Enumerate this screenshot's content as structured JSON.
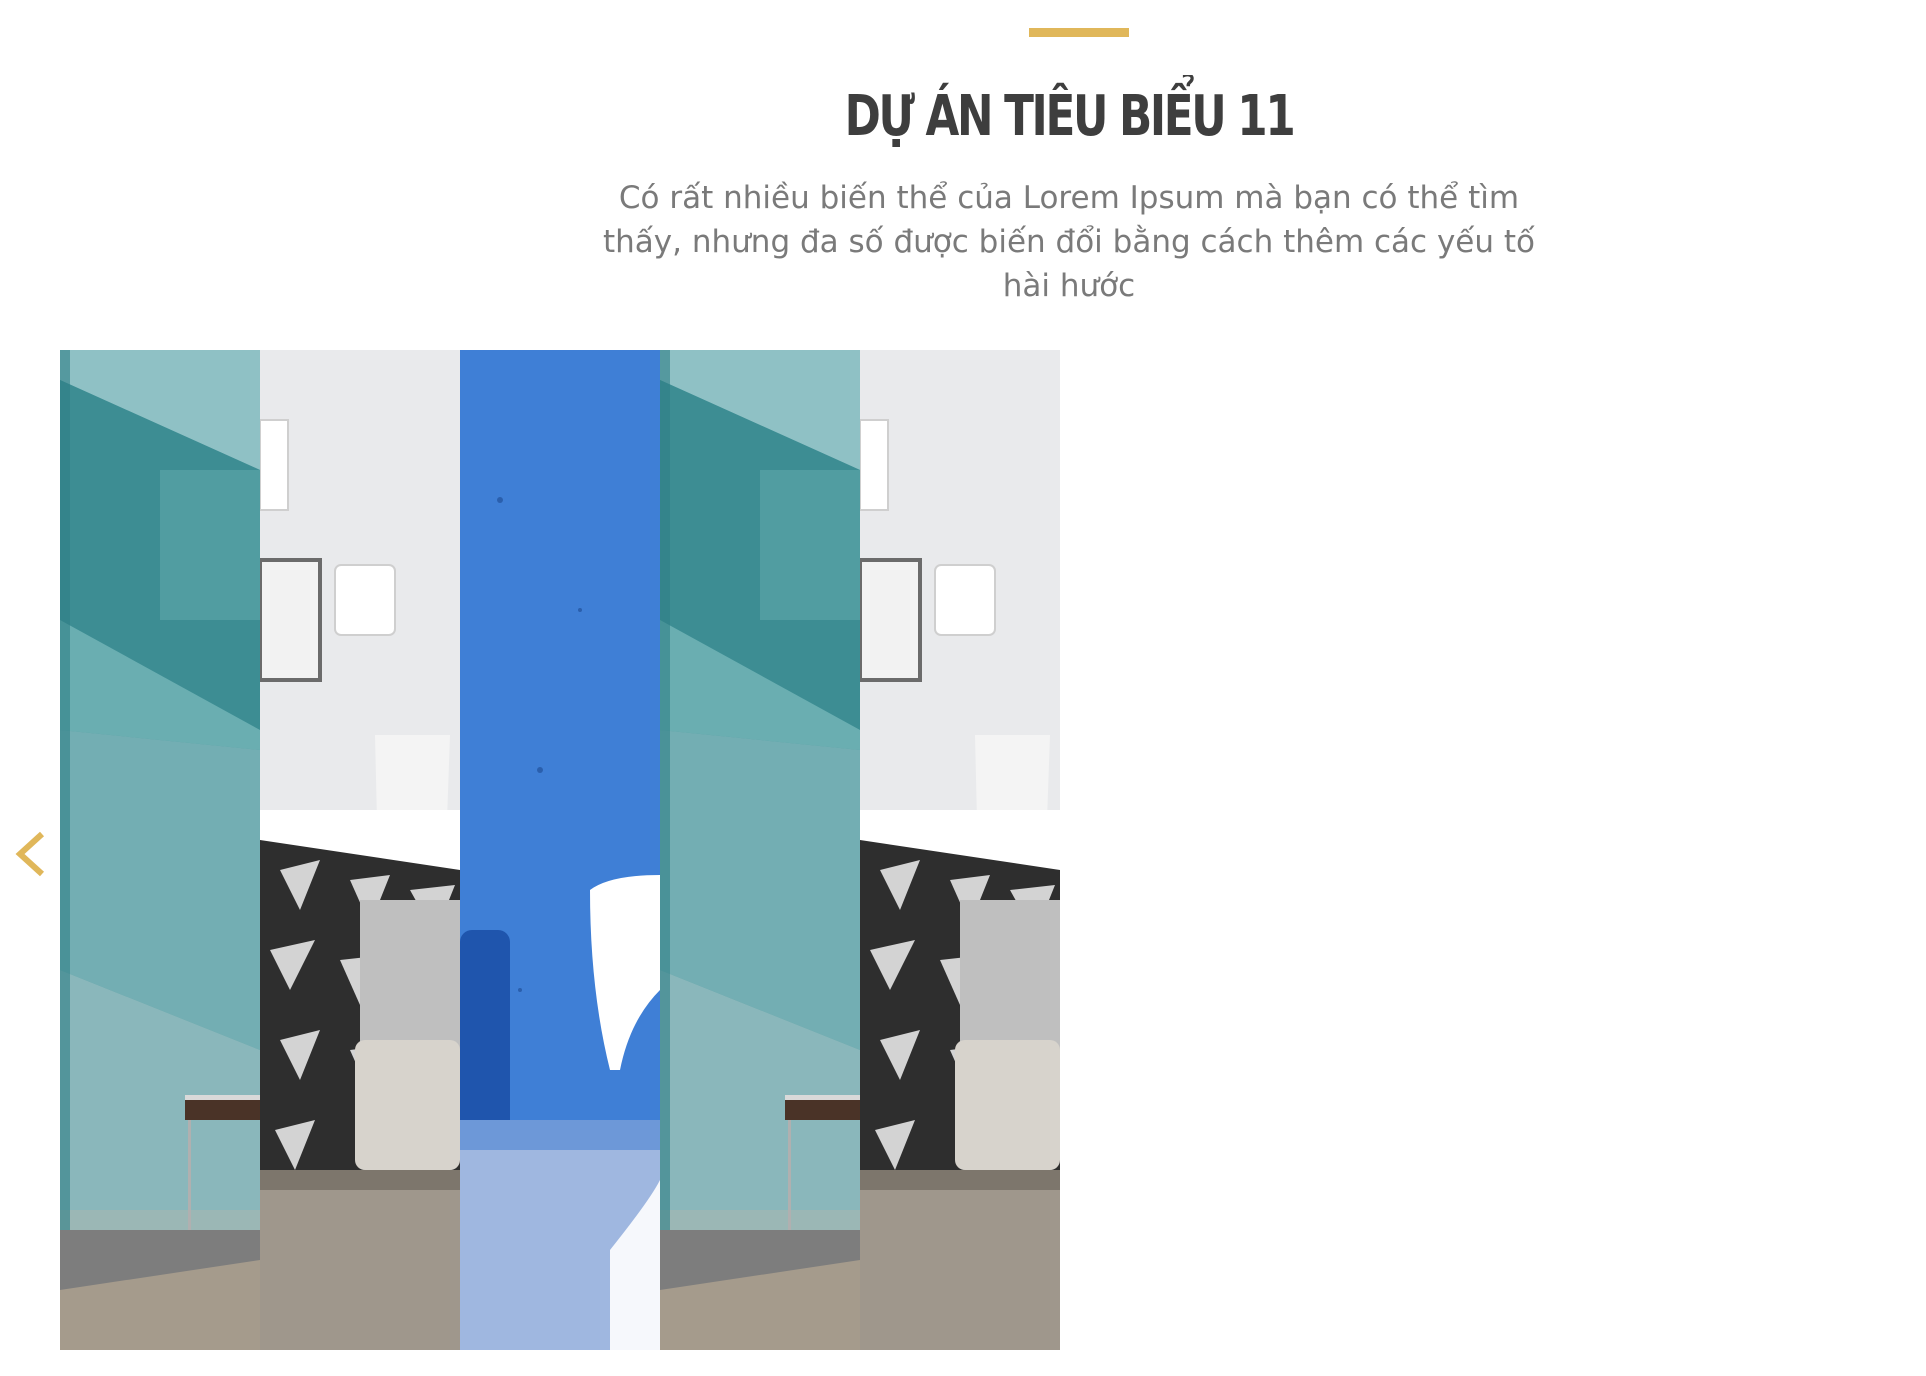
{
  "section": {
    "title": "DỰ ÁN TIÊU BIỂU 11",
    "description": "Có rất nhiều biến thể của Lorem Ipsum mà bạn có thể tìm thấy, nhưng đa số được biến đổi bằng cách thêm các yếu tố hài hước"
  },
  "colors": {
    "accent": "#e0b75a",
    "title": "#3e3e3e",
    "description": "#7a7a7a"
  },
  "carousel": {
    "prev_icon": "chevron-left-icon",
    "panels": [
      {
        "name": "panel-teal-wall"
      },
      {
        "name": "panel-bedroom"
      },
      {
        "name": "panel-blue-wall"
      },
      {
        "name": "panel-teal-wall"
      },
      {
        "name": "panel-bedroom"
      }
    ]
  }
}
